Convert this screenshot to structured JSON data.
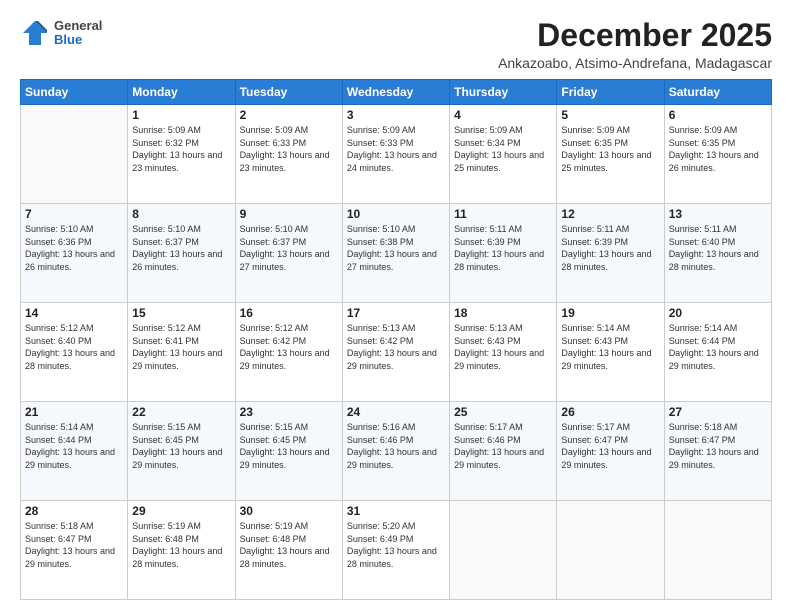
{
  "header": {
    "logo": {
      "general": "General",
      "blue": "Blue"
    },
    "title": "December 2025",
    "location": "Ankazoabo, Atsimo-Andrefana, Madagascar"
  },
  "calendar": {
    "days": [
      "Sunday",
      "Monday",
      "Tuesday",
      "Wednesday",
      "Thursday",
      "Friday",
      "Saturday"
    ],
    "weeks": [
      [
        {
          "day": "",
          "sunrise": "",
          "sunset": "",
          "daylight": ""
        },
        {
          "day": "1",
          "sunrise": "Sunrise: 5:09 AM",
          "sunset": "Sunset: 6:32 PM",
          "daylight": "Daylight: 13 hours and 23 minutes."
        },
        {
          "day": "2",
          "sunrise": "Sunrise: 5:09 AM",
          "sunset": "Sunset: 6:33 PM",
          "daylight": "Daylight: 13 hours and 23 minutes."
        },
        {
          "day": "3",
          "sunrise": "Sunrise: 5:09 AM",
          "sunset": "Sunset: 6:33 PM",
          "daylight": "Daylight: 13 hours and 24 minutes."
        },
        {
          "day": "4",
          "sunrise": "Sunrise: 5:09 AM",
          "sunset": "Sunset: 6:34 PM",
          "daylight": "Daylight: 13 hours and 25 minutes."
        },
        {
          "day": "5",
          "sunrise": "Sunrise: 5:09 AM",
          "sunset": "Sunset: 6:35 PM",
          "daylight": "Daylight: 13 hours and 25 minutes."
        },
        {
          "day": "6",
          "sunrise": "Sunrise: 5:09 AM",
          "sunset": "Sunset: 6:35 PM",
          "daylight": "Daylight: 13 hours and 26 minutes."
        }
      ],
      [
        {
          "day": "7",
          "sunrise": "Sunrise: 5:10 AM",
          "sunset": "Sunset: 6:36 PM",
          "daylight": "Daylight: 13 hours and 26 minutes."
        },
        {
          "day": "8",
          "sunrise": "Sunrise: 5:10 AM",
          "sunset": "Sunset: 6:37 PM",
          "daylight": "Daylight: 13 hours and 26 minutes."
        },
        {
          "day": "9",
          "sunrise": "Sunrise: 5:10 AM",
          "sunset": "Sunset: 6:37 PM",
          "daylight": "Daylight: 13 hours and 27 minutes."
        },
        {
          "day": "10",
          "sunrise": "Sunrise: 5:10 AM",
          "sunset": "Sunset: 6:38 PM",
          "daylight": "Daylight: 13 hours and 27 minutes."
        },
        {
          "day": "11",
          "sunrise": "Sunrise: 5:11 AM",
          "sunset": "Sunset: 6:39 PM",
          "daylight": "Daylight: 13 hours and 28 minutes."
        },
        {
          "day": "12",
          "sunrise": "Sunrise: 5:11 AM",
          "sunset": "Sunset: 6:39 PM",
          "daylight": "Daylight: 13 hours and 28 minutes."
        },
        {
          "day": "13",
          "sunrise": "Sunrise: 5:11 AM",
          "sunset": "Sunset: 6:40 PM",
          "daylight": "Daylight: 13 hours and 28 minutes."
        }
      ],
      [
        {
          "day": "14",
          "sunrise": "Sunrise: 5:12 AM",
          "sunset": "Sunset: 6:40 PM",
          "daylight": "Daylight: 13 hours and 28 minutes."
        },
        {
          "day": "15",
          "sunrise": "Sunrise: 5:12 AM",
          "sunset": "Sunset: 6:41 PM",
          "daylight": "Daylight: 13 hours and 29 minutes."
        },
        {
          "day": "16",
          "sunrise": "Sunrise: 5:12 AM",
          "sunset": "Sunset: 6:42 PM",
          "daylight": "Daylight: 13 hours and 29 minutes."
        },
        {
          "day": "17",
          "sunrise": "Sunrise: 5:13 AM",
          "sunset": "Sunset: 6:42 PM",
          "daylight": "Daylight: 13 hours and 29 minutes."
        },
        {
          "day": "18",
          "sunrise": "Sunrise: 5:13 AM",
          "sunset": "Sunset: 6:43 PM",
          "daylight": "Daylight: 13 hours and 29 minutes."
        },
        {
          "day": "19",
          "sunrise": "Sunrise: 5:14 AM",
          "sunset": "Sunset: 6:43 PM",
          "daylight": "Daylight: 13 hours and 29 minutes."
        },
        {
          "day": "20",
          "sunrise": "Sunrise: 5:14 AM",
          "sunset": "Sunset: 6:44 PM",
          "daylight": "Daylight: 13 hours and 29 minutes."
        }
      ],
      [
        {
          "day": "21",
          "sunrise": "Sunrise: 5:14 AM",
          "sunset": "Sunset: 6:44 PM",
          "daylight": "Daylight: 13 hours and 29 minutes."
        },
        {
          "day": "22",
          "sunrise": "Sunrise: 5:15 AM",
          "sunset": "Sunset: 6:45 PM",
          "daylight": "Daylight: 13 hours and 29 minutes."
        },
        {
          "day": "23",
          "sunrise": "Sunrise: 5:15 AM",
          "sunset": "Sunset: 6:45 PM",
          "daylight": "Daylight: 13 hours and 29 minutes."
        },
        {
          "day": "24",
          "sunrise": "Sunrise: 5:16 AM",
          "sunset": "Sunset: 6:46 PM",
          "daylight": "Daylight: 13 hours and 29 minutes."
        },
        {
          "day": "25",
          "sunrise": "Sunrise: 5:17 AM",
          "sunset": "Sunset: 6:46 PM",
          "daylight": "Daylight: 13 hours and 29 minutes."
        },
        {
          "day": "26",
          "sunrise": "Sunrise: 5:17 AM",
          "sunset": "Sunset: 6:47 PM",
          "daylight": "Daylight: 13 hours and 29 minutes."
        },
        {
          "day": "27",
          "sunrise": "Sunrise: 5:18 AM",
          "sunset": "Sunset: 6:47 PM",
          "daylight": "Daylight: 13 hours and 29 minutes."
        }
      ],
      [
        {
          "day": "28",
          "sunrise": "Sunrise: 5:18 AM",
          "sunset": "Sunset: 6:47 PM",
          "daylight": "Daylight: 13 hours and 29 minutes."
        },
        {
          "day": "29",
          "sunrise": "Sunrise: 5:19 AM",
          "sunset": "Sunset: 6:48 PM",
          "daylight": "Daylight: 13 hours and 28 minutes."
        },
        {
          "day": "30",
          "sunrise": "Sunrise: 5:19 AM",
          "sunset": "Sunset: 6:48 PM",
          "daylight": "Daylight: 13 hours and 28 minutes."
        },
        {
          "day": "31",
          "sunrise": "Sunrise: 5:20 AM",
          "sunset": "Sunset: 6:49 PM",
          "daylight": "Daylight: 13 hours and 28 minutes."
        },
        {
          "day": "",
          "sunrise": "",
          "sunset": "",
          "daylight": ""
        },
        {
          "day": "",
          "sunrise": "",
          "sunset": "",
          "daylight": ""
        },
        {
          "day": "",
          "sunrise": "",
          "sunset": "",
          "daylight": ""
        }
      ]
    ]
  }
}
